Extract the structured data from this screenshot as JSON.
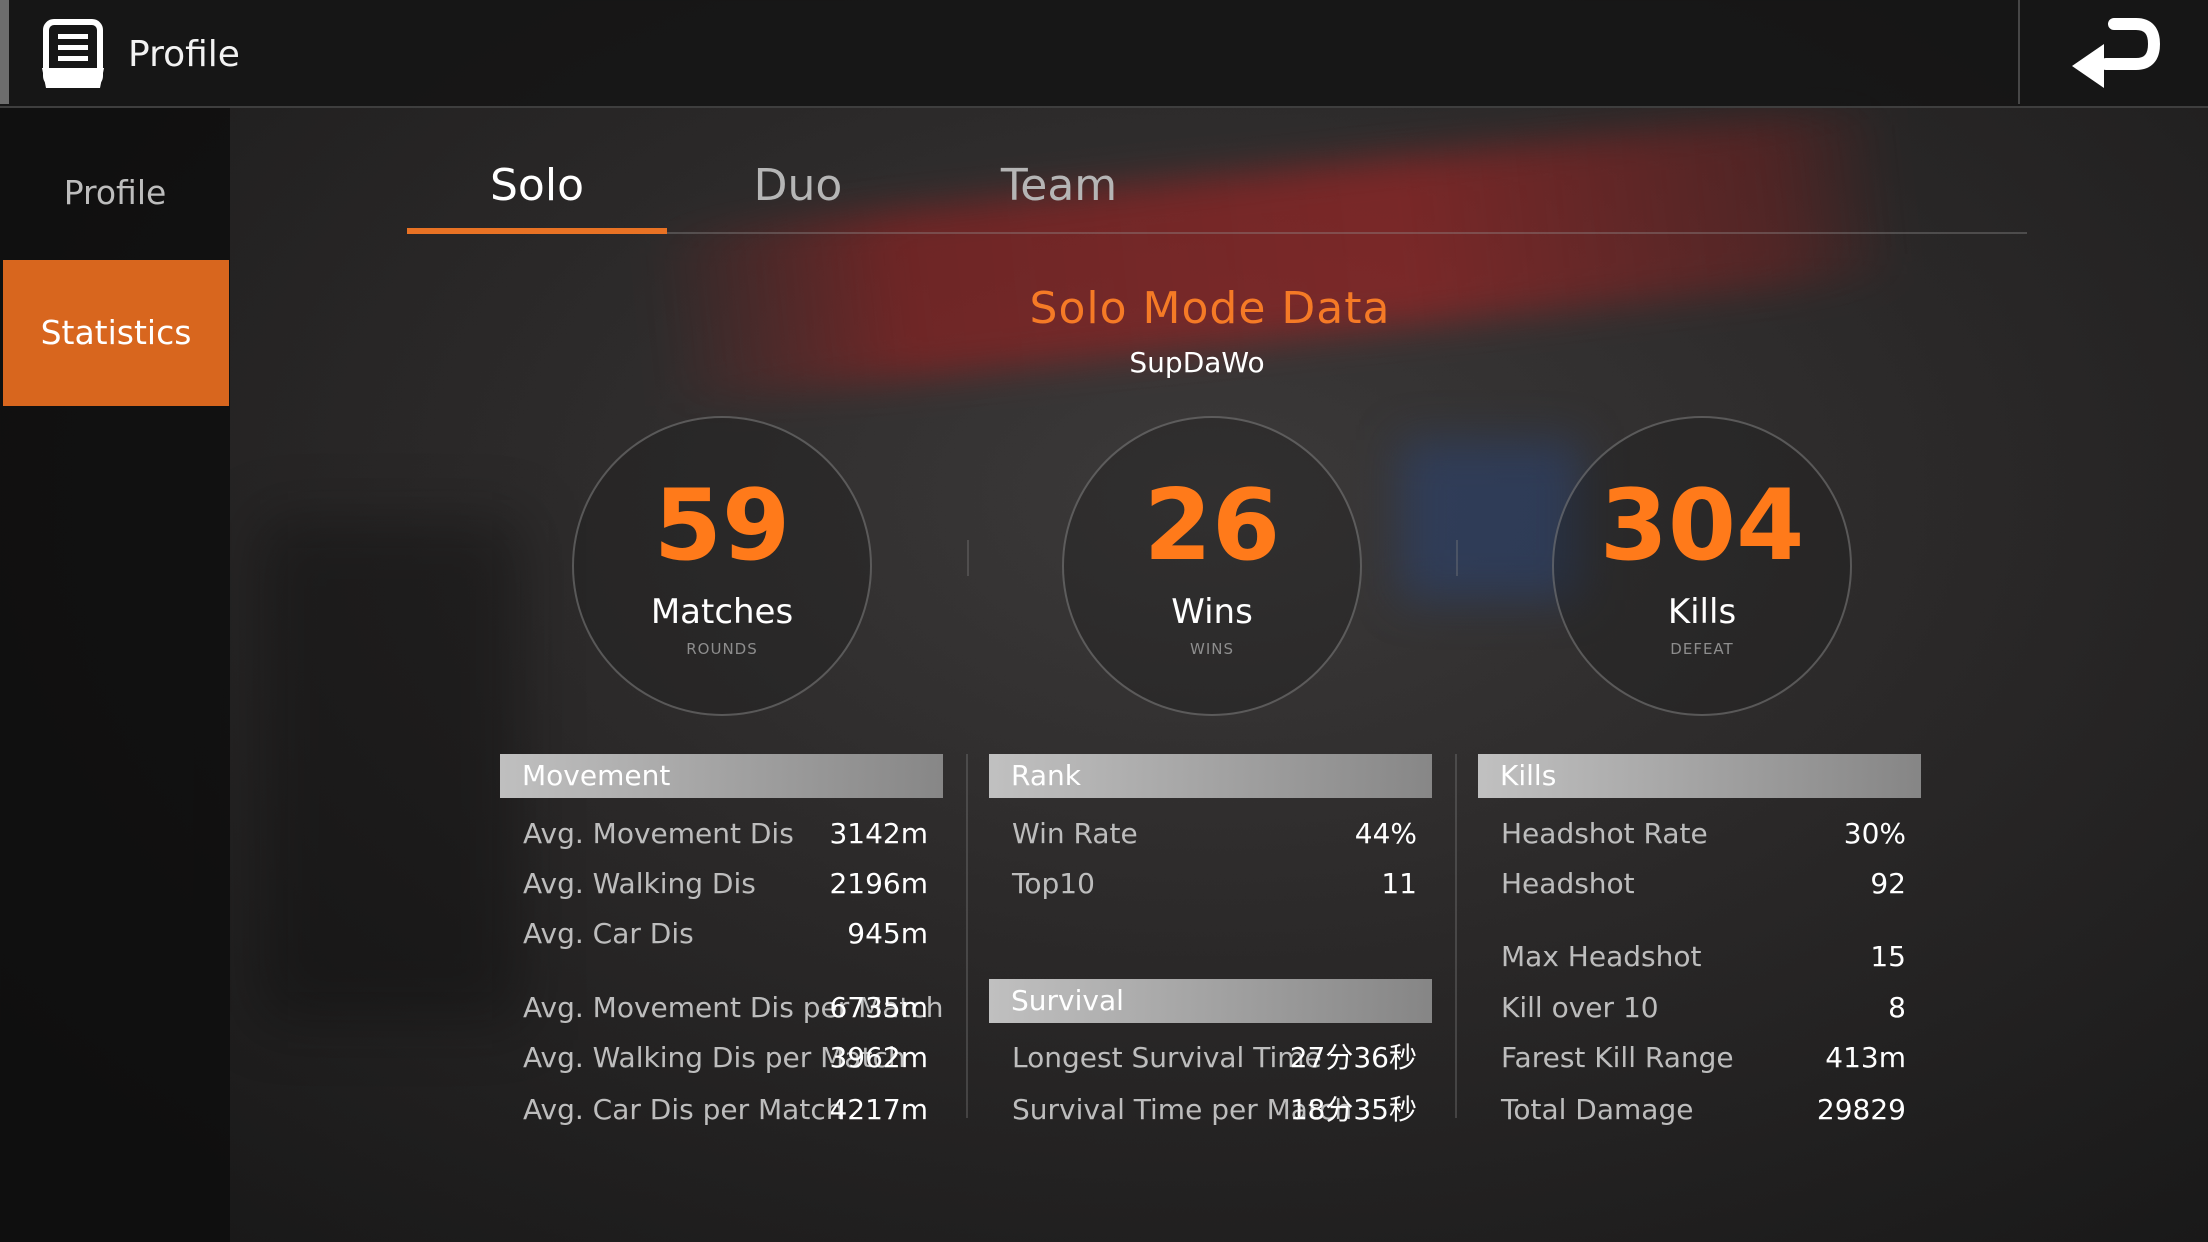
{
  "header": {
    "title": "Profile"
  },
  "sidebar": {
    "items": [
      {
        "label": "Profile"
      },
      {
        "label": "Statistics"
      }
    ]
  },
  "tabs": [
    {
      "label": "Solo"
    },
    {
      "label": "Duo"
    },
    {
      "label": "Team"
    }
  ],
  "main": {
    "title": "Solo Mode Data",
    "player": "SupDaWo",
    "stats": [
      {
        "value": "59",
        "label": "Matches",
        "sub": "ROUNDS"
      },
      {
        "value": "26",
        "label": "Wins",
        "sub": "WINS"
      },
      {
        "value": "304",
        "label": "Kills",
        "sub": "DEFEAT"
      }
    ],
    "movement": {
      "title": "Movement",
      "rows": [
        {
          "k": "Avg. Movement Dis",
          "v": "3142m"
        },
        {
          "k": "Avg. Walking Dis",
          "v": "2196m"
        },
        {
          "k": "Avg. Car Dis",
          "v": "945m"
        },
        {
          "k": "Avg. Movement Dis per Match",
          "v": "6735m"
        },
        {
          "k": "Avg. Walking Dis per Match",
          "v": "3962m"
        },
        {
          "k": "Avg. Car Dis per Match",
          "v": "4217m"
        }
      ]
    },
    "rank": {
      "title": "Rank",
      "rows": [
        {
          "k": "Win Rate",
          "v": "44%"
        },
        {
          "k": "Top10",
          "v": "11"
        }
      ]
    },
    "survival": {
      "title": "Survival",
      "rows": [
        {
          "k": "Longest Survival Time",
          "v": "27分36秒"
        },
        {
          "k": "Survival Time per Match",
          "v": "18分35秒"
        }
      ]
    },
    "kills": {
      "title": "Kills",
      "rows": [
        {
          "k": "Headshot Rate",
          "v": "30%"
        },
        {
          "k": "Headshot",
          "v": "92"
        },
        {
          "k": "Max Headshot",
          "v": "15"
        },
        {
          "k": "Kill over 10",
          "v": "8"
        },
        {
          "k": "Farest Kill Range",
          "v": "413m"
        },
        {
          "k": "Total Damage",
          "v": "29829"
        }
      ]
    }
  },
  "colors": {
    "accent": "#e87224",
    "number": "#ff7a1a",
    "sidebar_active": "#d8661e"
  },
  "icons": {
    "profile": "profile-document-icon",
    "back": "back-arrow-icon"
  }
}
